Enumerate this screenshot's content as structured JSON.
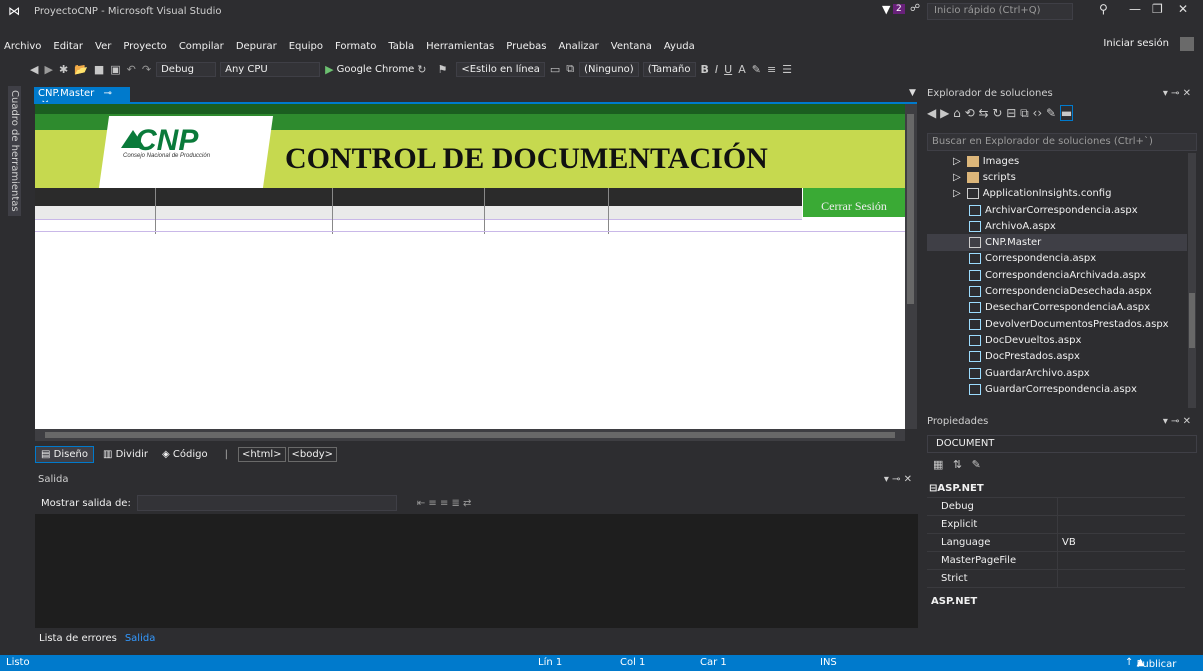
{
  "window": {
    "title": "ProyectoCNP - Microsoft Visual Studio",
    "notif_count": "2",
    "quick_launch_placeholder": "Inicio rápido (Ctrl+Q)"
  },
  "menu": [
    "Archivo",
    "Editar",
    "Ver",
    "Proyecto",
    "Compilar",
    "Depurar",
    "Equipo",
    "Formato",
    "Tabla",
    "Herramientas",
    "Pruebas",
    "Analizar",
    "Ventana",
    "Ayuda"
  ],
  "signin": "Iniciar sesión",
  "toolbar": {
    "config": "Debug",
    "platform": "Any CPU",
    "browser": "Google Chrome",
    "style": "<Estilo en línea",
    "font": "(Ninguno)",
    "size": "(Tamaño",
    "bold": "B",
    "italic": "I",
    "underline": "U"
  },
  "rail_label": "Cuadro de herramientas",
  "document_tab": "CNP.Master",
  "page": {
    "logo": "CNP",
    "logo_sub": "Consejo Nacional de Producción",
    "title": "CONTROL DE DOCUMENTACIÓN",
    "logout": "Cerrar Sesión"
  },
  "viewbar": {
    "design": "Diseño",
    "split": "Dividir",
    "code": "Código",
    "crumb_html": "<html>",
    "crumb_body": "<body>"
  },
  "output": {
    "title": "Salida",
    "show_label": "Mostrar salida de:"
  },
  "bottom_tabs": {
    "errors": "Lista de errores",
    "output": "Salida"
  },
  "solution_explorer": {
    "title": "Explorador de soluciones",
    "search_placeholder": "Buscar en Explorador de soluciones (Ctrl+`)",
    "items": [
      {
        "label": "Images",
        "type": "folder"
      },
      {
        "label": "scripts",
        "type": "folder"
      },
      {
        "label": "ApplicationInsights.config",
        "type": "config"
      },
      {
        "label": "ArchivarCorrespondencia.aspx",
        "type": "page"
      },
      {
        "label": "ArchivoA.aspx",
        "type": "page"
      },
      {
        "label": "CNP.Master",
        "type": "master"
      },
      {
        "label": "Correspondencia.aspx",
        "type": "page"
      },
      {
        "label": "CorrespondenciaArchivada.aspx",
        "type": "page"
      },
      {
        "label": "CorrespondenciaDesechada.aspx",
        "type": "page"
      },
      {
        "label": "DesecharCorrespondenciaA.aspx",
        "type": "page"
      },
      {
        "label": "DevolverDocumentosPrestados.aspx",
        "type": "page"
      },
      {
        "label": "DocDevueltos.aspx",
        "type": "page"
      },
      {
        "label": "DocPrestados.aspx",
        "type": "page"
      },
      {
        "label": "GuardarArchivo.aspx",
        "type": "page"
      },
      {
        "label": "GuardarCorrespondencia.aspx",
        "type": "page"
      }
    ]
  },
  "properties": {
    "title": "Propiedades",
    "object": "DOCUMENT",
    "category": "ASP.NET",
    "rows": [
      {
        "key": "Debug",
        "value": ""
      },
      {
        "key": "Explicit",
        "value": ""
      },
      {
        "key": "Language",
        "value": "VB"
      },
      {
        "key": "MasterPageFile",
        "value": ""
      },
      {
        "key": "Strict",
        "value": ""
      }
    ],
    "description": "ASP.NET"
  },
  "status": {
    "ready": "Listo",
    "line": "Lín 1",
    "col": "Col 1",
    "char": "Car 1",
    "mode": "INS",
    "publish": "Publicar"
  },
  "colors": {
    "accent": "#007acc",
    "bg": "#2d2d30",
    "cnp_green": "#3aaa35",
    "cnp_lime": "#c6d94f"
  }
}
